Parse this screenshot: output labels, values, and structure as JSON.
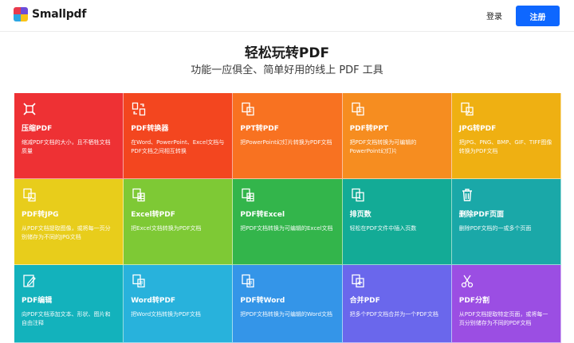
{
  "header": {
    "logo_text": "Smallpdf",
    "logo_colors": [
      "#e83a4d",
      "#6c4cd9",
      "#2ca6e3",
      "#f9c318"
    ],
    "login_label": "登录",
    "signup_label": "注册",
    "signup_color": "#0e67ff"
  },
  "hero": {
    "title": "轻松玩转PDF",
    "subtitle": "功能一应俱全、简单好用的线上 PDF 工具"
  },
  "tools": [
    {
      "title": "压缩PDF",
      "desc": "缩减PDF文档的大小，且不牺牲文档质量",
      "color": "#ee3134",
      "icon": "compress-icon"
    },
    {
      "title": "PDF转换器",
      "desc": "在Word、PowerPoint、Excel文档与PDF文档之间相互转换",
      "color": "#f3461f",
      "icon": "convert-icon"
    },
    {
      "title": "PPT转PDF",
      "desc": "把PowerPoint幻灯片转换为PDF文档",
      "color": "#f87221",
      "icon": "ppt-icon"
    },
    {
      "title": "PDF转PPT",
      "desc": "把PDF文档转换为可编辑的PowerPoint幻灯片",
      "color": "#f68d20",
      "icon": "ppt-icon"
    },
    {
      "title": "JPG转PDF",
      "desc": "把JPG、PNG、BMP、GIF、TIFF图像转换为PDF文档",
      "color": "#efb012",
      "icon": "image-icon"
    },
    {
      "title": "PDF转JPG",
      "desc": "从PDF文档提取图像，或将每一页分别储存为不同的JPG文档",
      "color": "#e8cd1b",
      "icon": "image-icon"
    },
    {
      "title": "Excel转PDF",
      "desc": "把Excel文档转换为PDF文档",
      "color": "#7ec935",
      "icon": "excel-icon"
    },
    {
      "title": "PDF转Excel",
      "desc": "把PDF文档转换为可编辑的Excel文档",
      "color": "#33b54b",
      "icon": "excel-icon"
    },
    {
      "title": "排页数",
      "desc": "轻松在PDF文件中插入页数",
      "color": "#13ab96",
      "icon": "page-number-icon"
    },
    {
      "title": "删除PDF页面",
      "desc": "删除PDF文档的一或多个页面",
      "color": "#1aa8a8",
      "icon": "trash-icon"
    },
    {
      "title": "PDF编辑",
      "desc": "向PDF文档添加文本、形状、图片和自由注释",
      "color": "#13b2bc",
      "icon": "edit-icon"
    },
    {
      "title": "Word转PDF",
      "desc": "把Word文档转换为PDF文档",
      "color": "#28b2dc",
      "icon": "word-icon"
    },
    {
      "title": "PDF转Word",
      "desc": "把PDF文档转换为可编辑的Word文档",
      "color": "#3495e8",
      "icon": "word-icon"
    },
    {
      "title": "合并PDF",
      "desc": "把多个PDF文档合并为一个PDF文档",
      "color": "#6a67ec",
      "icon": "merge-icon"
    },
    {
      "title": "PDF分割",
      "desc": "从PDF文档提取特定页面，或将每一页分别储存为不同的PDF文档",
      "color": "#9b4ee3",
      "icon": "scissors-icon"
    }
  ]
}
